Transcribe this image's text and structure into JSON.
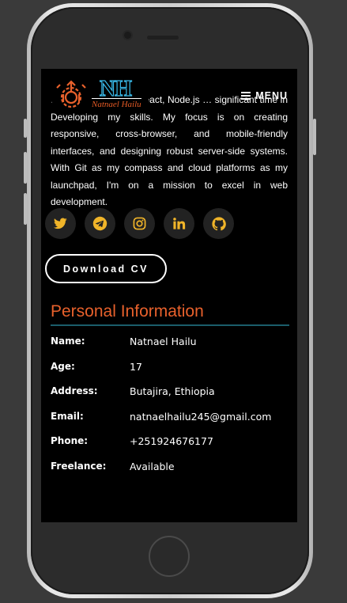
{
  "about": {
    "text": "… CSS, JavaScript, React, Node.js … significant time in Developing my skills. My focus is on creating responsive, cross-browser, and mobile-friendly interfaces, and designing robust server-side systems. With Git as my compass and cloud platforms as my launchpad, I'm on a mission to excel in web development."
  },
  "nav": {
    "logo_initials": "NH",
    "logo_name": "Natnael Hailu",
    "menu_label": "MENU"
  },
  "socials": [
    {
      "icon": "twitter-icon"
    },
    {
      "icon": "telegram-icon"
    },
    {
      "icon": "instagram-icon"
    },
    {
      "icon": "linkedin-icon"
    },
    {
      "icon": "github-icon"
    }
  ],
  "colors": {
    "accent": "#e8612c",
    "icon": "#f0b429",
    "divider": "#1b5d6b"
  },
  "cv_button": "Download CV",
  "personal": {
    "title": "Personal Information",
    "rows": [
      {
        "label": "Name:",
        "value": "Natnael Hailu"
      },
      {
        "label": "Age:",
        "value": "17"
      },
      {
        "label": "Address:",
        "value": "Butajira, Ethiopia"
      },
      {
        "label": "Email:",
        "value": "natnaelhailu245@gmail.com"
      },
      {
        "label": "Phone:",
        "value": "+251924676177"
      },
      {
        "label": "Freelance:",
        "value": "Available"
      }
    ]
  }
}
